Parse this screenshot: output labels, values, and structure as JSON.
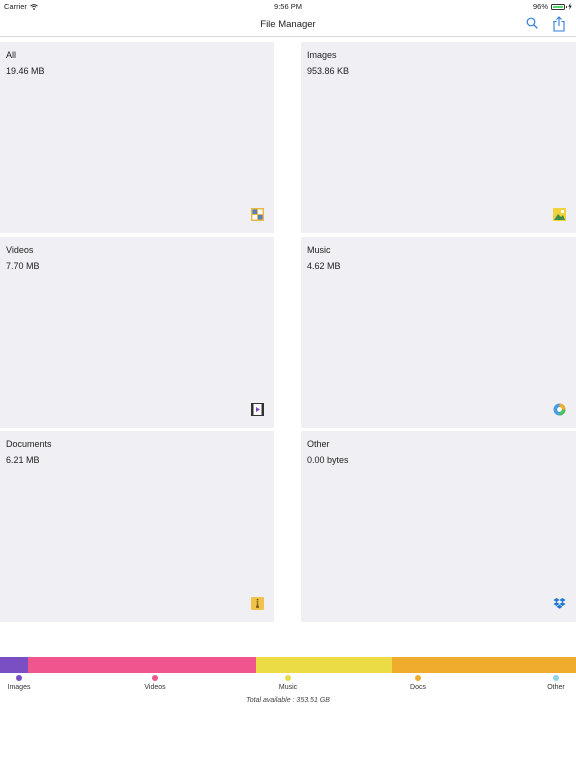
{
  "status_bar": {
    "carrier": "Carrier",
    "time": "9:56 PM",
    "battery": "96%"
  },
  "nav": {
    "title": "File Manager"
  },
  "tiles": [
    {
      "name": "All",
      "size": "19.46 MB",
      "icon": "grid-icon"
    },
    {
      "name": "Images",
      "size": "953.86 KB",
      "icon": "image-icon"
    },
    {
      "name": "Videos",
      "size": "7.70 MB",
      "icon": "film-icon"
    },
    {
      "name": "Music",
      "size": "4.62 MB",
      "icon": "music-icon"
    },
    {
      "name": "Documents",
      "size": "6.21 MB",
      "icon": "zip-icon"
    },
    {
      "name": "Other",
      "size": "0.00 bytes",
      "icon": "dropbox-icon"
    }
  ],
  "storage": {
    "segments": [
      {
        "name": "Images",
        "fraction": 0.048,
        "color": "#7b4fc4"
      },
      {
        "name": "Videos",
        "fraction": 0.396,
        "color": "#f0558e"
      },
      {
        "name": "Music",
        "fraction": 0.236,
        "color": "#ebdc45"
      },
      {
        "name": "Docs",
        "fraction": 0.32,
        "color": "#f0ad2d"
      }
    ],
    "legend": [
      {
        "label": "Images",
        "color": "#7b4fc4"
      },
      {
        "label": "Videos",
        "color": "#f0558e"
      },
      {
        "label": "Music",
        "color": "#ebdc45"
      },
      {
        "label": "Docs",
        "color": "#f0ad2d"
      },
      {
        "label": "Other",
        "color": "#8fd3e8"
      }
    ],
    "total_available": "Total available : 353.51 GB"
  }
}
